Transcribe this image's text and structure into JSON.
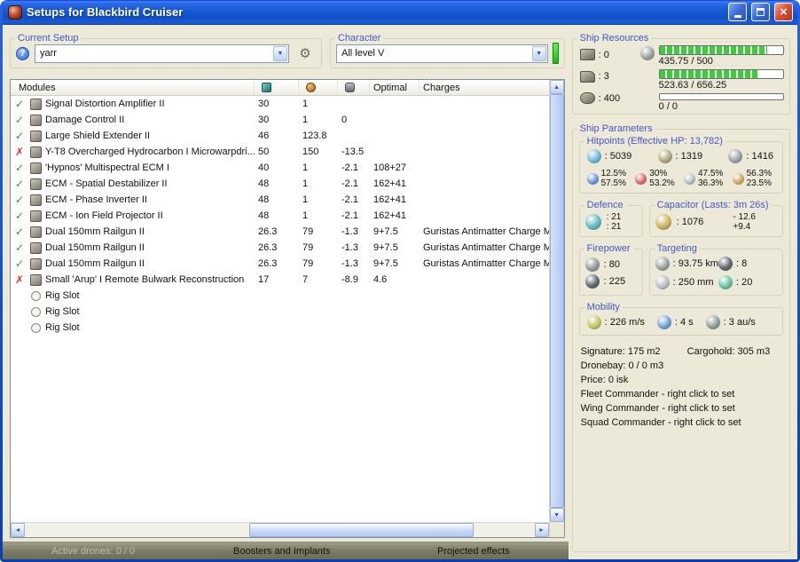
{
  "window": {
    "title": "Setups for Blackbird Cruiser"
  },
  "current_setup": {
    "label": "Current Setup",
    "value": "yarr"
  },
  "character": {
    "label": "Character",
    "value": "All level V"
  },
  "ship_resources": {
    "label": "Ship Resources",
    "hardpoints": [
      {
        "name": "launcher-hardpoints",
        "value": ": 0"
      },
      {
        "name": "turret-hardpoints",
        "value": ": 3"
      },
      {
        "name": "calibration",
        "value": ": 400"
      }
    ],
    "cpu_bar": {
      "text": "435.75 / 500",
      "pct": 87
    },
    "pg_bar": {
      "text": "523.63 / 656.25",
      "pct": 80
    },
    "drone_bar": {
      "text": "0 / 0",
      "pct": 0
    }
  },
  "modules": {
    "header": {
      "name": "Modules",
      "optimal": "Optimal",
      "charges": "Charges"
    },
    "rows": [
      {
        "status": "ok",
        "name": "Signal Distortion Amplifier II",
        "cpu": "30",
        "pg": "1",
        "cap": "",
        "optimal": "",
        "charges": ""
      },
      {
        "status": "ok",
        "name": "Damage Control II",
        "cpu": "30",
        "pg": "1",
        "cap": "0",
        "optimal": "",
        "charges": ""
      },
      {
        "status": "ok",
        "name": "Large Shield Extender II",
        "cpu": "46",
        "pg": "123.8",
        "cap": "",
        "optimal": "",
        "charges": ""
      },
      {
        "status": "error",
        "name": "Y-T8 Overcharged Hydrocarbon I Microwarpdri...",
        "cpu": "50",
        "pg": "150",
        "cap": "-13.5",
        "optimal": "",
        "charges": ""
      },
      {
        "status": "ok",
        "name": "'Hypnos' Multispectral ECM I",
        "cpu": "40",
        "pg": "1",
        "cap": "-2.1",
        "optimal": "108+27",
        "charges": ""
      },
      {
        "status": "ok",
        "name": "ECM - Spatial Destabilizer II",
        "cpu": "48",
        "pg": "1",
        "cap": "-2.1",
        "optimal": "162+41",
        "charges": ""
      },
      {
        "status": "ok",
        "name": "ECM - Phase Inverter II",
        "cpu": "48",
        "pg": "1",
        "cap": "-2.1",
        "optimal": "162+41",
        "charges": ""
      },
      {
        "status": "ok",
        "name": "ECM - Ion Field Projector II",
        "cpu": "48",
        "pg": "1",
        "cap": "-2.1",
        "optimal": "162+41",
        "charges": ""
      },
      {
        "status": "ok",
        "name": "Dual 150mm Railgun II",
        "cpu": "26.3",
        "pg": "79",
        "cap": "-1.3",
        "optimal": "9+7.5",
        "charges": "Guristas Antimatter Charge M"
      },
      {
        "status": "ok",
        "name": "Dual 150mm Railgun II",
        "cpu": "26.3",
        "pg": "79",
        "cap": "-1.3",
        "optimal": "9+7.5",
        "charges": "Guristas Antimatter Charge M"
      },
      {
        "status": "ok",
        "name": "Dual 150mm Railgun II",
        "cpu": "26.3",
        "pg": "79",
        "cap": "-1.3",
        "optimal": "9+7.5",
        "charges": "Guristas Antimatter Charge M"
      },
      {
        "status": "error",
        "name": "Small 'Arup' I Remote Bulwark Reconstruction",
        "cpu": "17",
        "pg": "7",
        "cap": "-8.9",
        "optimal": "4.6",
        "charges": ""
      },
      {
        "status": "rig",
        "name": "Rig Slot",
        "cpu": "",
        "pg": "",
        "cap": "",
        "optimal": "",
        "charges": ""
      },
      {
        "status": "rig",
        "name": "Rig Slot",
        "cpu": "",
        "pg": "",
        "cap": "",
        "optimal": "",
        "charges": ""
      },
      {
        "status": "rig",
        "name": "Rig Slot",
        "cpu": "",
        "pg": "",
        "cap": "",
        "optimal": "",
        "charges": ""
      }
    ]
  },
  "ship_parameters": {
    "label": "Ship Parameters",
    "hitpoints": {
      "label": "Hitpoints (Effective HP: 13,782)",
      "shield": ": 5039",
      "armor": ": 1319",
      "structure": ": 1416",
      "resists": [
        {
          "top": "12.5%",
          "bottom": "57.5%"
        },
        {
          "top": "30%",
          "bottom": "53.2%"
        },
        {
          "top": "47.5%",
          "bottom": "36.3%"
        },
        {
          "top": "56.3%",
          "bottom": "23.5%"
        }
      ]
    },
    "defence": {
      "label": "Defence",
      "top": ": 21",
      "bottom": ": 21"
    },
    "capacitor": {
      "label": "Capacitor (Lasts: 3m 26s)",
      "amount": ": 1076",
      "delta_top": "- 12.6",
      "delta_bottom": "+9.4"
    },
    "firepower": {
      "label": "Firepower",
      "volley": ": 80",
      "dps": ": 225"
    },
    "targeting": {
      "label": "Targeting",
      "range": ": 93.75 km",
      "max_targets": ": 8",
      "scan_resolution": ": 250 mm",
      "sensor_strength": ": 20"
    },
    "mobility": {
      "label": "Mobility",
      "speed": ": 226 m/s",
      "align": ": 4 s",
      "warp": ": 3 au/s"
    },
    "info": {
      "signature": "Signature: 175 m2",
      "cargohold": "Cargohold: 305 m3",
      "dronebay": "Dronebay: 0 / 0 m3",
      "price": "Price: 0 isk",
      "fleet": "Fleet Commander - right click to set",
      "wing": "Wing Commander - right click to set",
      "squad": "Squad Commander - right click to set"
    }
  },
  "bottom_bar": {
    "active_drones": "Active drones: 0 / 0",
    "boosters": "Boosters and Implants",
    "projected": "Projected effects"
  },
  "colors": {
    "label_blue": "#4557c5",
    "ok_green": "#1fa51f",
    "error_red": "#e03131",
    "bar_green": "#41c941",
    "em": "#6b93d6",
    "thermal": "#d66b6b",
    "kinetic": "#b9bec4",
    "explosive": "#d6a36b",
    "shield": "#69b7d6",
    "armor": "#b0a883",
    "structure": "#9aa0a6",
    "defence": "#5fb7c2",
    "capacitor": "#c9b35c",
    "turret": "#8f969c",
    "dark": "#5d646b",
    "gray": "#9aa09e",
    "sensor": "#67c2a0",
    "speed": "#c2c25f",
    "agility": "#6fa0d6",
    "warp": "#8f9c96"
  }
}
